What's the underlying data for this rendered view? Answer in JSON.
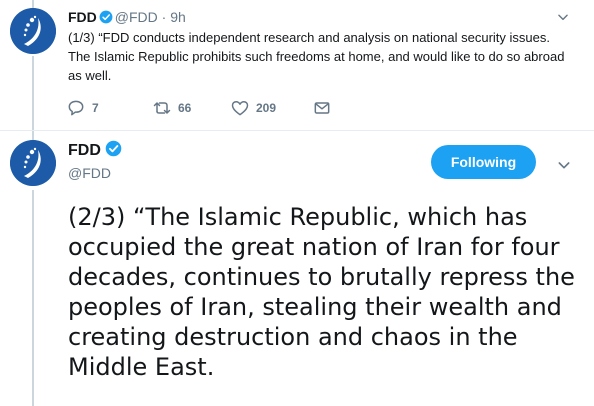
{
  "tweet1": {
    "name": "FDD",
    "handle": "@FDD",
    "separator": "·",
    "time": "9h",
    "text": "(1/3) “FDD conducts independent research and analysis on national security issues. The Islamic Republic prohibits such freedoms at home, and would like to do so abroad as well.",
    "replies": "7",
    "retweets": "66",
    "likes": "209"
  },
  "tweet2": {
    "name": "FDD",
    "handle": "@FDD",
    "follow_label": "Following",
    "text": "(2/3) “The Islamic Republic, which has occupied the great nation of Iran for four decades, continues to brutally repress the peoples of Iran, stealing their wealth and creating destruction and chaos in the Middle East."
  },
  "colors": {
    "accent": "#1da1f2",
    "avatar_bg": "#1d5ba8",
    "muted": "#657786",
    "text": "#14171a"
  },
  "icons": [
    "verified-badge-icon",
    "chevron-down-icon",
    "reply-icon",
    "retweet-icon",
    "like-icon",
    "direct-message-icon",
    "fdd-logo-icon"
  ]
}
